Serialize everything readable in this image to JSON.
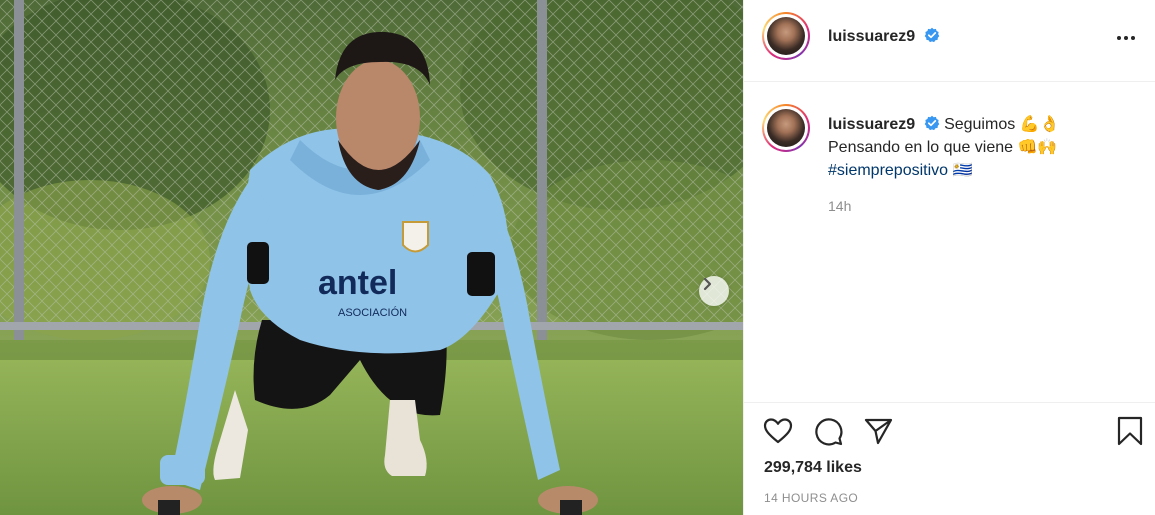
{
  "post": {
    "photo_alt": "Player doing push-ups on grass",
    "next_label": "›"
  },
  "header": {
    "username": "luissuarez9",
    "verified_icon": "verified-badge-icon",
    "more_icon": "more-options-icon"
  },
  "caption": {
    "username": "luissuarez9",
    "line1": "Seguimos",
    "line1_emoji": [
      "💪",
      "👌"
    ],
    "line2": "Pensando en lo que viene",
    "line2_emoji": [
      "👊",
      "🙌"
    ],
    "hashtag": "#siemprepositivo",
    "flag_emoji": "🇺🇾",
    "time_ago": "14h"
  },
  "actions": {
    "like_icon": "heart-icon",
    "comment_icon": "comment-icon",
    "share_icon": "share-icon",
    "save_icon": "bookmark-icon"
  },
  "stats": {
    "likes": "299,784 likes",
    "posted": "14 HOURS AGO"
  },
  "colors": {
    "verified": "#3897f0",
    "link": "#00376b",
    "secondary_text": "#8e8e8e",
    "jersey": "#8fc3e8"
  }
}
